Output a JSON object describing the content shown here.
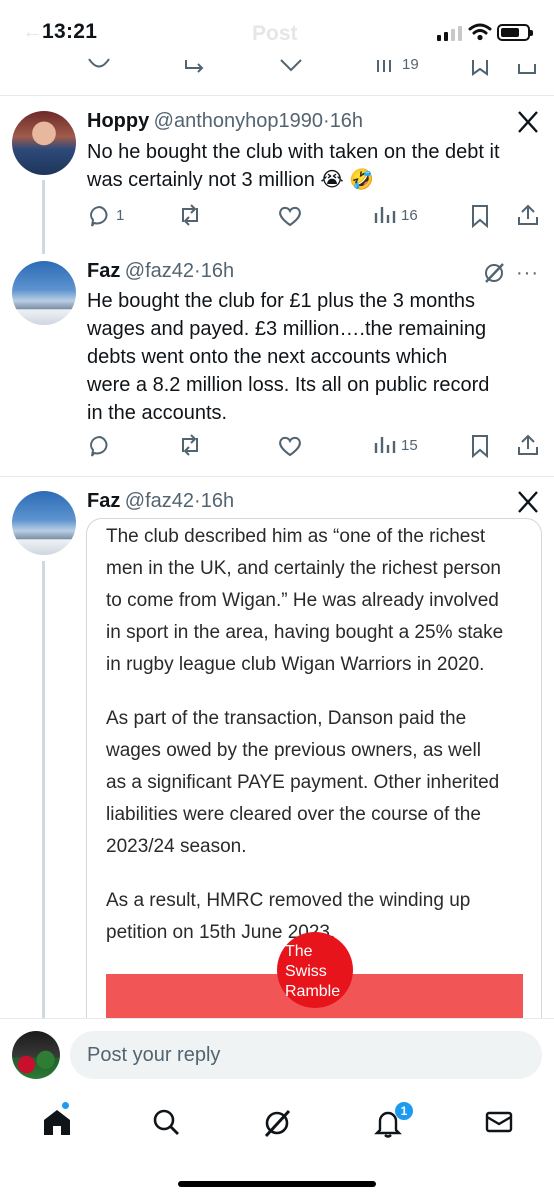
{
  "status_bar": {
    "time": "13:21",
    "header_ghost": "Post"
  },
  "prev_tweet": {
    "views": "19"
  },
  "tweets": [
    {
      "name": "Hoppy",
      "handle": "@anthonyhop1990",
      "dot": "·",
      "time": "16h",
      "text_line1": "No he bought the club with taken on the debt it",
      "text_line2": "was certainly not 3 million 😭 🤣",
      "replies": "1",
      "views": "16"
    },
    {
      "name": "Faz",
      "handle": "@faz42",
      "dot": "·",
      "time": "16h",
      "text_lines": [
        "He bought the club for £1 plus the 3 months",
        "wages and payed.  £3 million….the remaining",
        "debts went onto the next accounts which",
        "were a 8.2 million loss.  Its all on public record",
        "in the accounts."
      ],
      "views": "15"
    },
    {
      "name": "Faz",
      "handle": "@faz42",
      "dot": "·",
      "time": "16h",
      "card": {
        "p1": [
          "The club described him as “one of the richest",
          "men in the UK, and certainly the richest person",
          "to come from Wigan.” He was already involved",
          "in sport in the area, having bought a 25% stake",
          "in rugby league club Wigan Warriors in 2020."
        ],
        "p2": [
          "As part of the transaction, Danson paid the",
          "wages owed by the previous owners, as well",
          "as a significant PAYE payment. Other inherited",
          "liabilities were cleared over the course of the",
          "2023/24 season."
        ],
        "p3": [
          "As a result, HMRC removed the winding up",
          "petition on 15th June 2023."
        ],
        "watermark": [
          "The",
          "Swiss",
          "Ramble"
        ]
      }
    }
  ],
  "reply_bar": {
    "placeholder": "Post your reply"
  },
  "tabs": {
    "notifications_badge": "1"
  },
  "colors": {
    "accent": "#1d9bf0",
    "card_banner": "#f25555",
    "watermark": "#e8141b"
  }
}
